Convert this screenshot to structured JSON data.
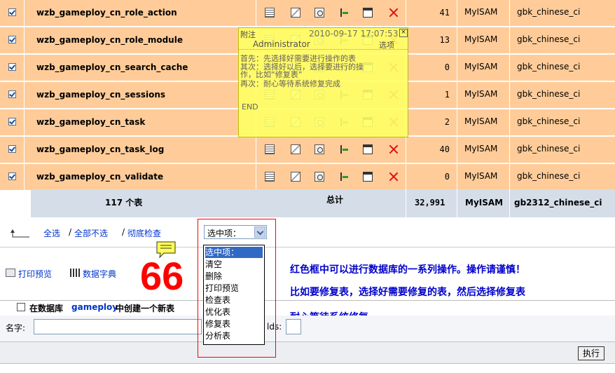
{
  "rows": [
    {
      "name": "wzb_gameploy_cn_role_action",
      "records": "41",
      "engine": "MyISAM",
      "collation": "gbk_chinese_ci"
    },
    {
      "name": "wzb_gameploy_cn_role_module",
      "records": "13",
      "engine": "MyISAM",
      "collation": "gbk_chinese_ci"
    },
    {
      "name": "wzb_gameploy_cn_search_cache",
      "records": "0",
      "engine": "MyISAM",
      "collation": "gbk_chinese_ci"
    },
    {
      "name": "wzb_gameploy_cn_sessions",
      "records": "1",
      "engine": "MyISAM",
      "collation": "gbk_chinese_ci"
    },
    {
      "name": "wzb_gameploy_cn_task",
      "records": "2",
      "engine": "MyISAM",
      "collation": "gbk_chinese_ci"
    },
    {
      "name": "wzb_gameploy_cn_task_log",
      "records": "40",
      "engine": "MyISAM",
      "collation": "gbk_chinese_ci"
    },
    {
      "name": "wzb_gameploy_cn_validate",
      "records": "0",
      "engine": "MyISAM",
      "collation": "gbk_chinese_ci"
    }
  ],
  "summary": {
    "tables": "117 个表",
    "total_label": "总计",
    "records": "32,991",
    "engine": "MyISAM",
    "collation": "gb2312_chinese_ci"
  },
  "note": {
    "tag": "附注",
    "timestamp": "2010-09-17 17:07:53",
    "author": "Administrator",
    "menu": "选项",
    "lines": [
      "首先：先选择好需要进行操作的表",
      "其次：选择好以后，选择要进行的操",
      "作，比如“修复表”",
      "再次：耐心等待系统修复完成"
    ],
    "end": "END"
  },
  "selection": {
    "check_all": "全选",
    "uncheck_all": "全部不选",
    "check_overhead": "彻底检查"
  },
  "dropdown": {
    "selected": "选中项：",
    "options": [
      "选中项：",
      "清空",
      "删除",
      "打印预览",
      "检查表",
      "优化表",
      "修复表",
      "分析表"
    ]
  },
  "tools": {
    "print": "打印预览",
    "dictionary": "数据字典"
  },
  "badge": "66",
  "annotations": [
    "红色框中可以进行数据库的一系列操作。操作请谨慎！",
    "比如要修复表，选择好需要修复的表，然后选择修复表",
    "耐心等待系统修复"
  ],
  "create": {
    "prefix": "在数据库",
    "db": "gameploy",
    "suffix": "中创建一个新表",
    "name_label": "名字:",
    "fields_label": "lds:"
  },
  "execute": "执行",
  "colors": {
    "row_bg": "#ffcc99",
    "summary_bg": "#d5dde8",
    "note_bg": "#ffff66",
    "link": "#0033cc",
    "annot": "#0000cc",
    "badge": "#ff0000"
  }
}
